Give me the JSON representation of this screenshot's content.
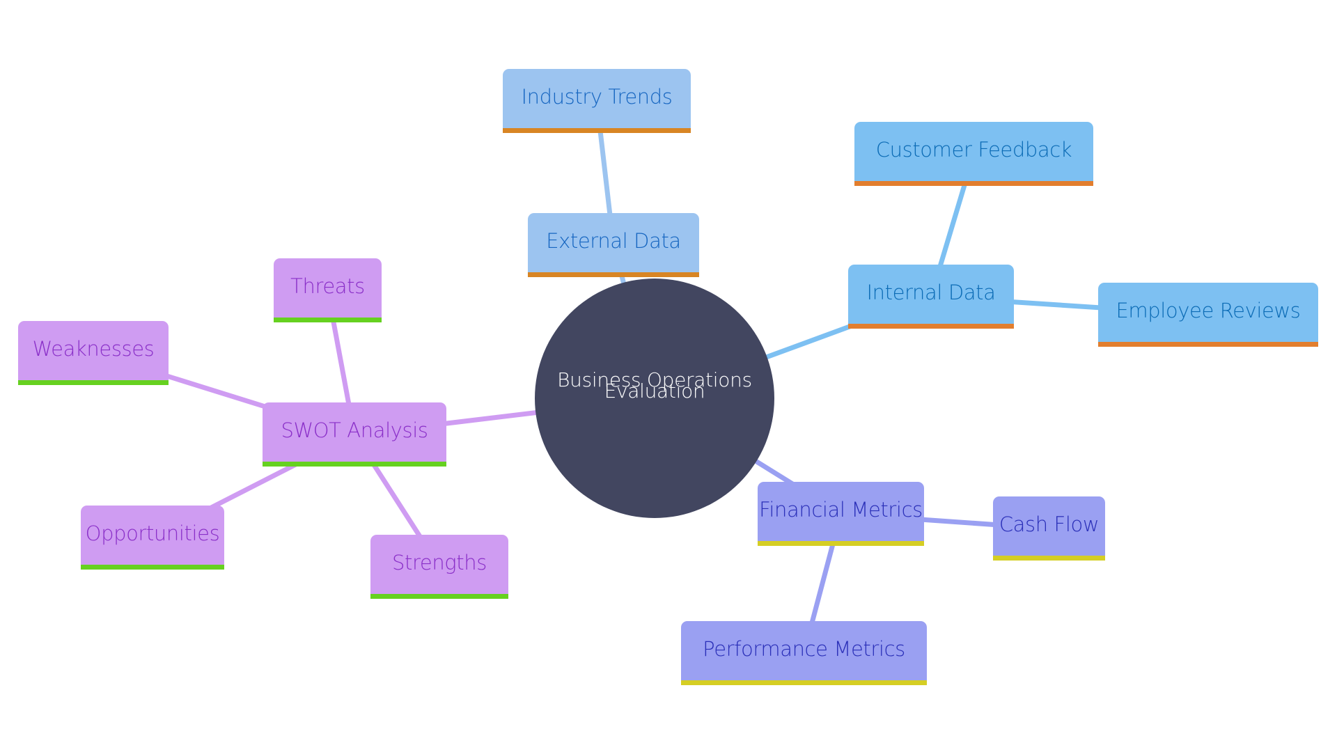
{
  "diagram": {
    "type": "mindmap",
    "root": {
      "id": "root",
      "label_line1": "Business Operations",
      "label_line2": "Evaluation",
      "color": "#424660"
    },
    "nodes": [
      {
        "id": "external",
        "label": "External Data",
        "parent": "root",
        "branch": "external"
      },
      {
        "id": "industry",
        "label": "Industry Trends",
        "parent": "external",
        "branch": "external"
      },
      {
        "id": "internal",
        "label": "Internal Data",
        "parent": "root",
        "branch": "internal"
      },
      {
        "id": "customer",
        "label": "Customer Feedback",
        "parent": "internal",
        "branch": "internal"
      },
      {
        "id": "employee",
        "label": "Employee Reviews",
        "parent": "internal",
        "branch": "internal"
      },
      {
        "id": "financial",
        "label": "Financial Metrics",
        "parent": "root",
        "branch": "financial"
      },
      {
        "id": "cashflow",
        "label": "Cash Flow",
        "parent": "financial",
        "branch": "financial"
      },
      {
        "id": "performance",
        "label": "Performance Metrics",
        "parent": "financial",
        "branch": "financial"
      },
      {
        "id": "swot",
        "label": "SWOT Analysis",
        "parent": "root",
        "branch": "swot"
      },
      {
        "id": "threats",
        "label": "Threats",
        "parent": "swot",
        "branch": "swot"
      },
      {
        "id": "weaknesses",
        "label": "Weaknesses",
        "parent": "swot",
        "branch": "swot"
      },
      {
        "id": "opportunities",
        "label": "Opportunities",
        "parent": "swot",
        "branch": "swot"
      },
      {
        "id": "strengths",
        "label": "Strengths",
        "parent": "swot",
        "branch": "swot"
      }
    ],
    "branch_colors": {
      "external": {
        "fill": "#9CC4F0",
        "text": "#1565C0",
        "underline": "#D88524",
        "edge": "#9CC4F0"
      },
      "internal": {
        "fill": "#7DC0F2",
        "text": "#0B6BB5",
        "underline": "#E27E2E",
        "edge": "#7DC0F2"
      },
      "financial": {
        "fill": "#9AA0F2",
        "text": "#2A2FB8",
        "underline": "#D5CE24",
        "edge": "#9AA0F2"
      },
      "swot": {
        "fill": "#CF9CF2",
        "text": "#8A2FC8",
        "underline": "#66D120",
        "edge": "#CF9CF2"
      }
    }
  }
}
